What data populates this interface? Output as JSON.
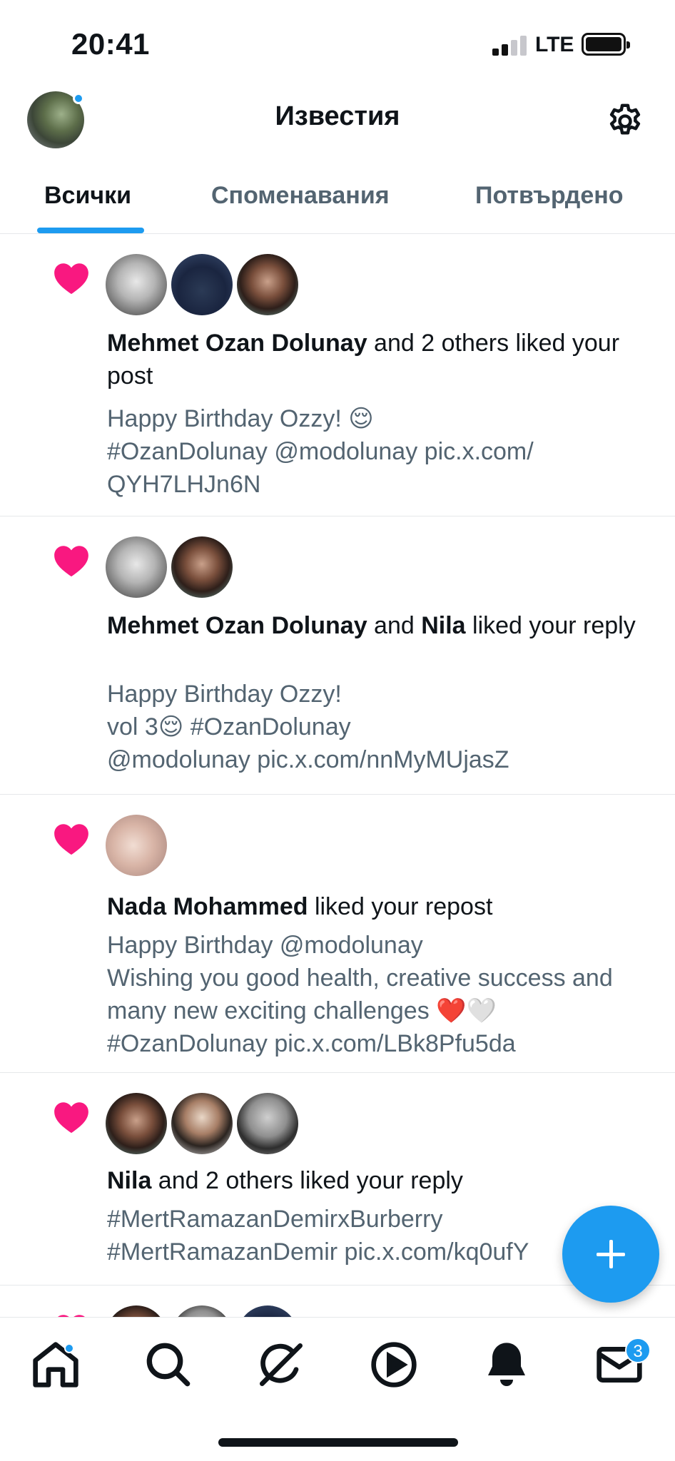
{
  "status_bar": {
    "time": "20:41",
    "network": "LTE"
  },
  "header": {
    "title": "Известия",
    "settings_icon": "gear-icon"
  },
  "tabs": [
    {
      "label": "Всички",
      "active": true
    },
    {
      "label": "Споменавания",
      "active": false
    },
    {
      "label": "Потвърдено",
      "active": false
    }
  ],
  "notifications": [
    {
      "actor": "Mehmet Ozan Dolunay",
      "rest": " and 2 others liked your post",
      "preview": "Happy Birthday Ozzy! 😌\n#OzanDolunay @modolunay pic.x.com/\nQYH7LHJn6N"
    },
    {
      "actor": "Mehmet Ozan Dolunay",
      "mid": " and ",
      "actor2": "Nila",
      "rest": " liked your reply",
      "preview": "Happy Birthday Ozzy!\n vol 3😌 #OzanDolunay\n@modolunay pic.x.com/nnMyMUjasZ"
    },
    {
      "actor": "Nada Mohammed",
      "rest": " liked your repost",
      "preview": "Happy Birthday @modolunay\nWishing you good health, creative success and\nmany new exciting challenges ❤️🤍\n#OzanDolunay pic.x.com/LBk8Pfu5da"
    },
    {
      "actor": "Nila",
      "rest": " and 2 others liked your reply",
      "preview": "#MertRamazanDemirxBurberry\n#MertRamazanDemir pic.x.com/kq0ufY"
    }
  ],
  "fab": {
    "icon": "plus-icon"
  },
  "bottom_nav": {
    "items": [
      "home-icon",
      "search-icon",
      "grok-icon",
      "play-icon",
      "bell-icon",
      "mail-icon"
    ],
    "messages_badge": "3"
  },
  "colors": {
    "accent": "#1d9bf0",
    "like": "#f91880",
    "muted_text": "#536471"
  }
}
